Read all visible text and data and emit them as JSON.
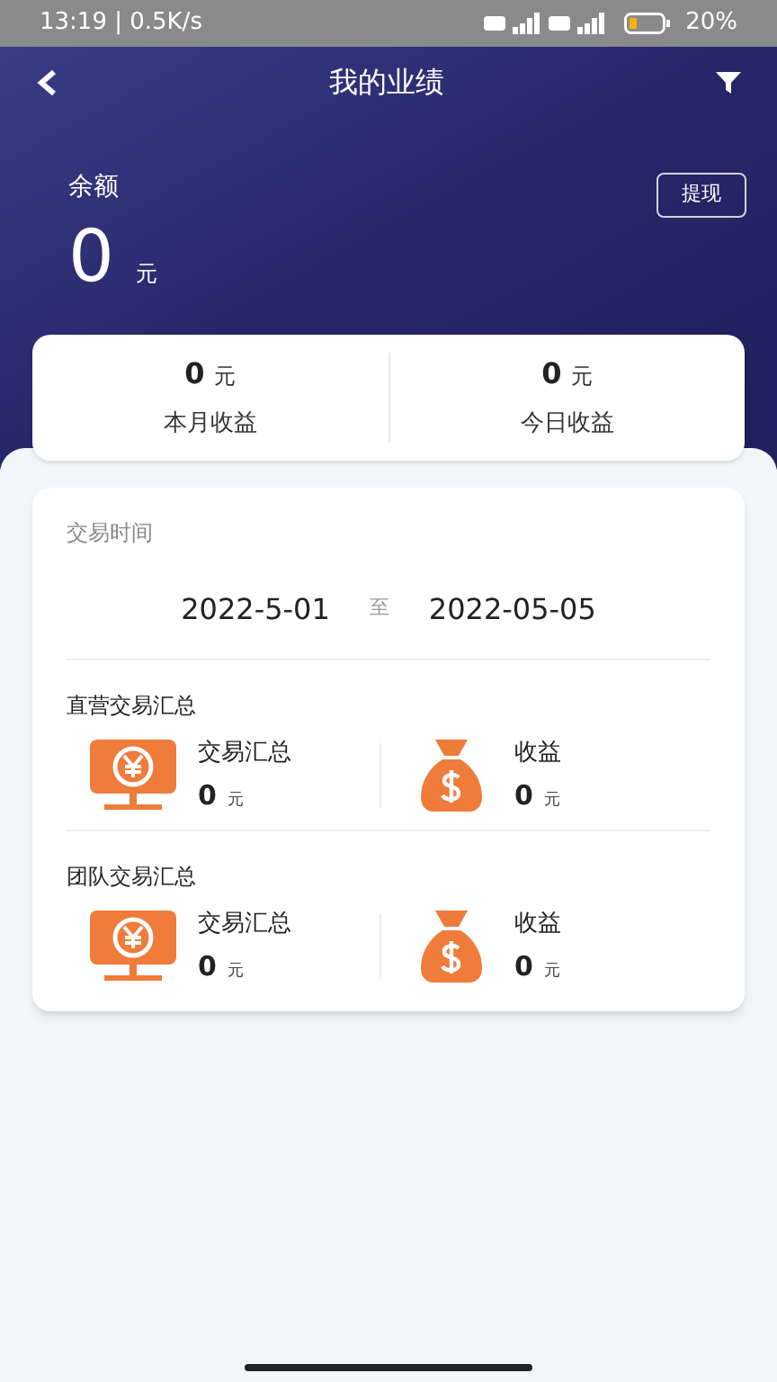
{
  "status_bar": {
    "time": "13:19 | 0.5K/s",
    "battery": "20%"
  },
  "header": {
    "title": "我的业绩",
    "balance_label": "余额",
    "balance": "0",
    "balance_unit": "元",
    "withdraw_button": "提现"
  },
  "summary": [
    {
      "value": "0",
      "unit": "元",
      "label": "本月收益"
    },
    {
      "value": "0",
      "unit": "元",
      "label": "今日收益"
    }
  ],
  "period": {
    "label": "交易时间",
    "start": "2022-5-01",
    "separator": "至",
    "end": "2022-05-05"
  },
  "sections": [
    {
      "title": "直营交易汇总",
      "items": [
        {
          "kind": "trade",
          "label": "交易汇总",
          "value": "0",
          "unit": "元"
        },
        {
          "kind": "income",
          "label": "收益",
          "value": "0",
          "unit": "元"
        }
      ]
    },
    {
      "title": "团队交易汇总",
      "items": [
        {
          "kind": "trade",
          "label": "交易汇总",
          "value": "0",
          "unit": "元"
        },
        {
          "kind": "income",
          "label": "收益",
          "value": "0",
          "unit": "元"
        }
      ]
    }
  ]
}
